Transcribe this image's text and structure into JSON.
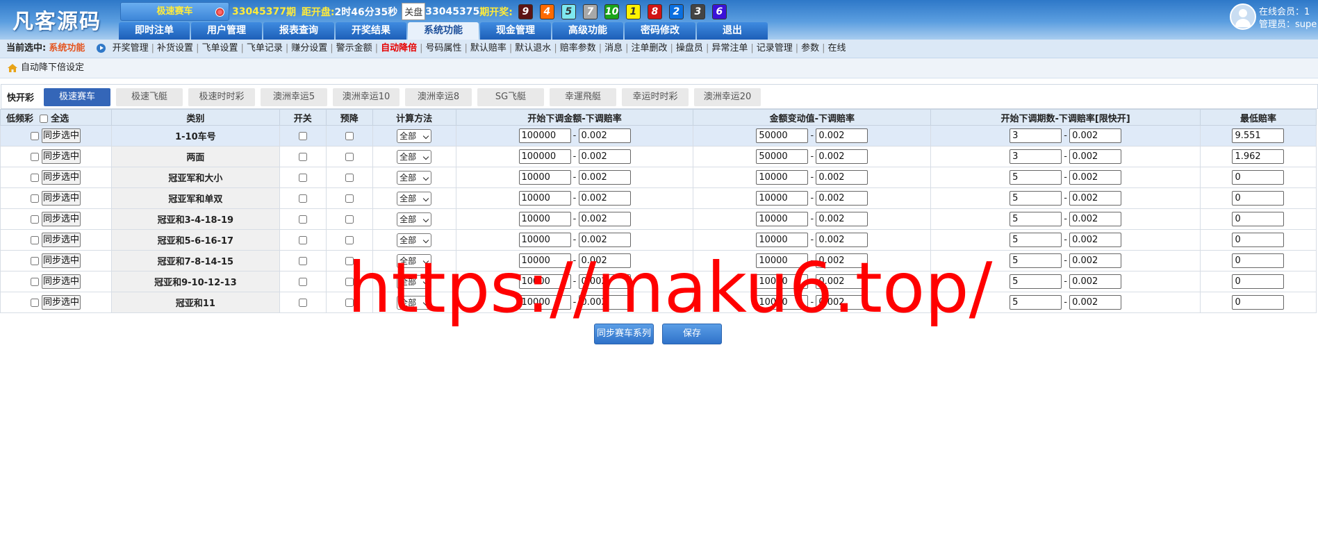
{
  "header": {
    "logo": "凡客源码",
    "game_button": "极速赛车",
    "current_period": "33045377",
    "period_suffix": "期",
    "countdown_label": "距开盘:",
    "countdown_value": "2时46分35秒",
    "close_tag": "关盘",
    "last_period": "33045375",
    "last_suffix": "期开奖:",
    "balls": [
      {
        "n": "9",
        "bg": "#5c1414",
        "fg": "#ffffff"
      },
      {
        "n": "4",
        "bg": "#ff6a00",
        "fg": "#ffffff"
      },
      {
        "n": "5",
        "bg": "#7ee8f0",
        "fg": "#333333"
      },
      {
        "n": "7",
        "bg": "#a8a8a8",
        "fg": "#ffffff"
      },
      {
        "n": "10",
        "bg": "#1aa51a",
        "fg": "#ffffff"
      },
      {
        "n": "1",
        "bg": "#fff200",
        "fg": "#333333"
      },
      {
        "n": "8",
        "bg": "#d11414",
        "fg": "#ffffff"
      },
      {
        "n": "2",
        "bg": "#0a6fe0",
        "fg": "#ffffff"
      },
      {
        "n": "3",
        "bg": "#444444",
        "fg": "#ffffff"
      },
      {
        "n": "6",
        "bg": "#3a12d8",
        "fg": "#ffffff"
      }
    ],
    "nav": [
      "即时注单",
      "用户管理",
      "报表查询",
      "开奖结果",
      "系统功能",
      "现金管理",
      "高级功能",
      "密码修改",
      "退出"
    ],
    "nav_active": 4,
    "online_label": "在线会员：1",
    "admin_label": "管理员：supe"
  },
  "subnav": {
    "current_label": "当前选中:",
    "current_value": "系统功能",
    "items": [
      "开奖管理",
      "补货设置",
      "飞单设置",
      "飞单记录",
      "赚分设置",
      "警示金额",
      "自动降倍",
      "号码属性",
      "默认赔率",
      "默认退水",
      "赔率参数",
      "消息",
      "注单删改",
      "操盘员",
      "异常注单",
      "记录管理",
      "参数",
      "在线"
    ],
    "active_item": "自动降倍"
  },
  "breadcrumb": "自动降下倍设定",
  "lottery": {
    "title": "快开彩",
    "tabs": [
      "极速赛车",
      "极速飞艇",
      "极速时时彩",
      "澳洲幸运5",
      "澳洲幸运10",
      "澳洲幸运8",
      "SG飞艇",
      "幸運飛艇",
      "幸运时时彩",
      "澳洲幸运20"
    ],
    "active": 0
  },
  "table": {
    "headers": [
      "低频彩",
      "全选",
      "类别",
      "开关",
      "预降",
      "计算方法",
      "开始下调金额-下调赔率",
      "金额变动值-下调赔率",
      "开始下调期数-下调赔率[限快开]",
      "最低赔率"
    ],
    "sync_label": "同步选中",
    "method": "全部",
    "rows": [
      {
        "cat": "1-10车号",
        "a1": "100000",
        "a2": "0.002",
        "b1": "50000",
        "b2": "0.002",
        "c1": "3",
        "c2": "0.002",
        "min": "9.551"
      },
      {
        "cat": "两面",
        "a1": "100000",
        "a2": "0.002",
        "b1": "50000",
        "b2": "0.002",
        "c1": "3",
        "c2": "0.002",
        "min": "1.962"
      },
      {
        "cat": "冠亚军和大小",
        "a1": "10000",
        "a2": "0.002",
        "b1": "10000",
        "b2": "0.002",
        "c1": "5",
        "c2": "0.002",
        "min": "0"
      },
      {
        "cat": "冠亚军和单双",
        "a1": "10000",
        "a2": "0.002",
        "b1": "10000",
        "b2": "0.002",
        "c1": "5",
        "c2": "0.002",
        "min": "0"
      },
      {
        "cat": "冠亚和3-4-18-19",
        "a1": "10000",
        "a2": "0.002",
        "b1": "10000",
        "b2": "0.002",
        "c1": "5",
        "c2": "0.002",
        "min": "0"
      },
      {
        "cat": "冠亚和5-6-16-17",
        "a1": "10000",
        "a2": "0.002",
        "b1": "10000",
        "b2": "0.002",
        "c1": "5",
        "c2": "0.002",
        "min": "0"
      },
      {
        "cat": "冠亚和7-8-14-15",
        "a1": "10000",
        "a2": "0.002",
        "b1": "10000",
        "b2": "0.002",
        "c1": "5",
        "c2": "0.002",
        "min": "0"
      },
      {
        "cat": "冠亚和9-10-12-13",
        "a1": "10000",
        "a2": "0.002",
        "b1": "10000",
        "b2": "0.002",
        "c1": "5",
        "c2": "0.002",
        "min": "0"
      },
      {
        "cat": "冠亚和11",
        "a1": "10000",
        "a2": "0.002",
        "b1": "10000",
        "b2": "0.002",
        "c1": "5",
        "c2": "0.002",
        "min": "0"
      }
    ]
  },
  "actions": {
    "sync_series": "同步赛车系列",
    "save": "保存"
  },
  "watermark": "https://maku6.top/"
}
